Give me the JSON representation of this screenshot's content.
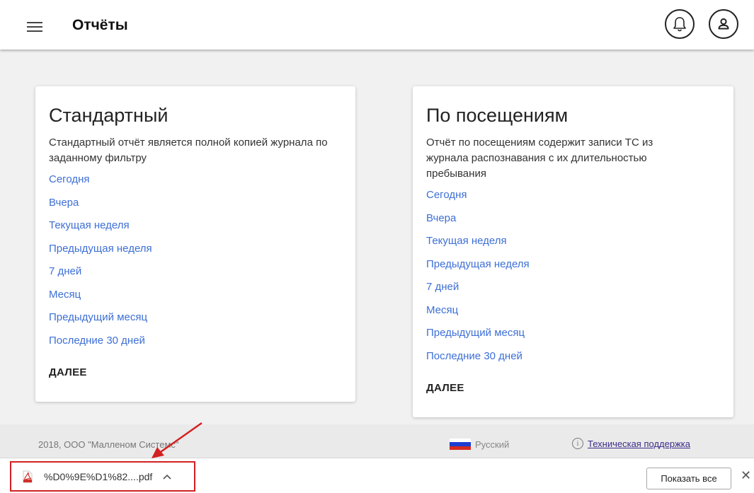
{
  "header": {
    "title": "Отчёты",
    "notifications_icon": "bell-icon",
    "profile_icon": "user-icon"
  },
  "cards": [
    {
      "title": "Стандартный",
      "description": "Стандартный отчёт является полной копией журнала по заданному фильтру",
      "links": [
        "Сегодня",
        "Вчера",
        "Текущая неделя",
        "Предыдущая неделя",
        "7 дней",
        "Месяц",
        "Предыдущий месяц",
        "Последние 30 дней"
      ],
      "next_label": "ДАЛЕЕ"
    },
    {
      "title": "По посещениям",
      "description": "Отчёт по посещениям содержит записи ТС из журнала распознавания с их длительностью пребывания",
      "links": [
        "Сегодня",
        "Вчера",
        "Текущая неделя",
        "Предыдущая неделя",
        "7 дней",
        "Месяц",
        "Предыдущий месяц",
        "Последние 30 дней"
      ],
      "next_label": "ДАЛЕЕ"
    }
  ],
  "footer": {
    "copyright": "2018, ООО \"Малленом Системс\"",
    "language": "Русский",
    "support": "Техническая поддержка"
  },
  "download_bar": {
    "file_name": "%D0%9E%D1%82....pdf",
    "show_all": "Показать все",
    "close": "✕"
  },
  "colors": {
    "link": "#3d6fd6",
    "highlight": "#d32020"
  }
}
